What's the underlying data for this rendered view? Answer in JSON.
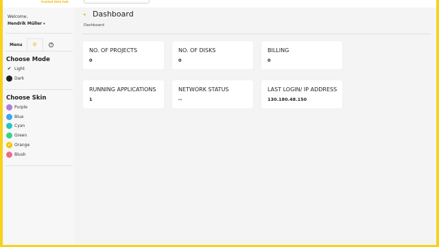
{
  "header": {
    "tagline": "trusted data hub"
  },
  "sidebar": {
    "welcome": "Welcome,",
    "username": "Hendrik Müller",
    "tabs": {
      "menu": "Menu"
    },
    "mode": {
      "title": "Choose Mode",
      "options": [
        {
          "label": "Light",
          "selected": true
        },
        {
          "label": "Dark",
          "color": "#222222"
        }
      ]
    },
    "skin": {
      "title": "Choose Skin",
      "options": [
        {
          "label": "Purple",
          "color": "#b07ad6"
        },
        {
          "label": "Blue",
          "color": "#3ea6ef"
        },
        {
          "label": "Cyan",
          "color": "#26c6c1"
        },
        {
          "label": "Green",
          "color": "#3fd08a"
        },
        {
          "label": "Orange",
          "color": "#f5c300",
          "selected": true
        },
        {
          "label": "Blush",
          "color": "#f06b8a"
        }
      ]
    }
  },
  "main": {
    "title": "Dashboard",
    "breadcrumb": "Dashboard",
    "cards": [
      {
        "label": "NO. OF PROJECTS",
        "value": "0"
      },
      {
        "label": "NO. OF DISKS",
        "value": "0"
      },
      {
        "label": "BILLING",
        "value": "0"
      },
      {
        "label": "RUNNING APPLICATIONS",
        "value": "1"
      },
      {
        "label": "NETWORK STATUS",
        "value": "--"
      },
      {
        "label": "LAST LOGIN/ IP ADDRESS",
        "value": "130.180.48.150"
      }
    ]
  },
  "colors": {
    "accent": "#f6d21a"
  }
}
